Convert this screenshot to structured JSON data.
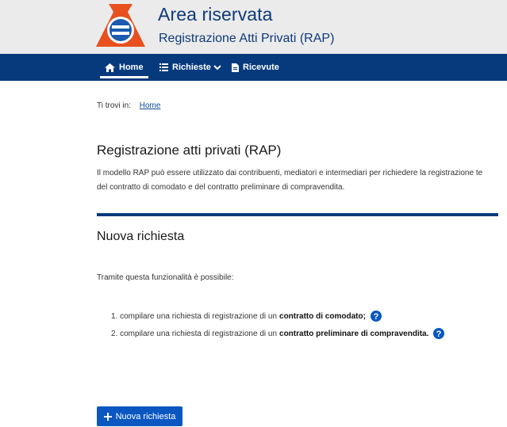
{
  "header": {
    "title": "Area riservata",
    "subtitle": "Registrazione Atti Privati (RAP)"
  },
  "nav": {
    "home": "Home",
    "richieste": "Richieste",
    "ricevute": "Ricevute"
  },
  "breadcrumb": {
    "prefix": "Ti trovi in:",
    "link": "Home"
  },
  "intro": {
    "title": "Registrazione atti privati (RAP)",
    "line1": "Il modello RAP può essere utilizzato dai contribuenti, mediatori e intermediari per richiedere la registrazione te",
    "line2": "del contratto di comodato e del contratto preliminare di compravendita."
  },
  "section": {
    "title": "Nuova richiesta",
    "lead": "Tramite questa funzionalità è possibile:",
    "steps": [
      {
        "num": "1.",
        "text": "compilare una richiesta di registrazione di un",
        "bold": "contratto di comodato;"
      },
      {
        "num": "2.",
        "text": "compilare una richiesta di registrazione di un",
        "bold": "contratto preliminare di compravendita."
      }
    ]
  },
  "button": {
    "label": "Nuova richiesta"
  },
  "colors": {
    "brand": "#063a7c",
    "title": "#0e3a7a",
    "button": "#0a57c2"
  },
  "icons": {
    "logo": "agenzia-entrate-logo",
    "home": "home-icon",
    "list": "list-icon",
    "chevron": "chevron-down-icon",
    "document": "document-icon",
    "help": "help-circle-icon",
    "plus": "plus-icon"
  }
}
